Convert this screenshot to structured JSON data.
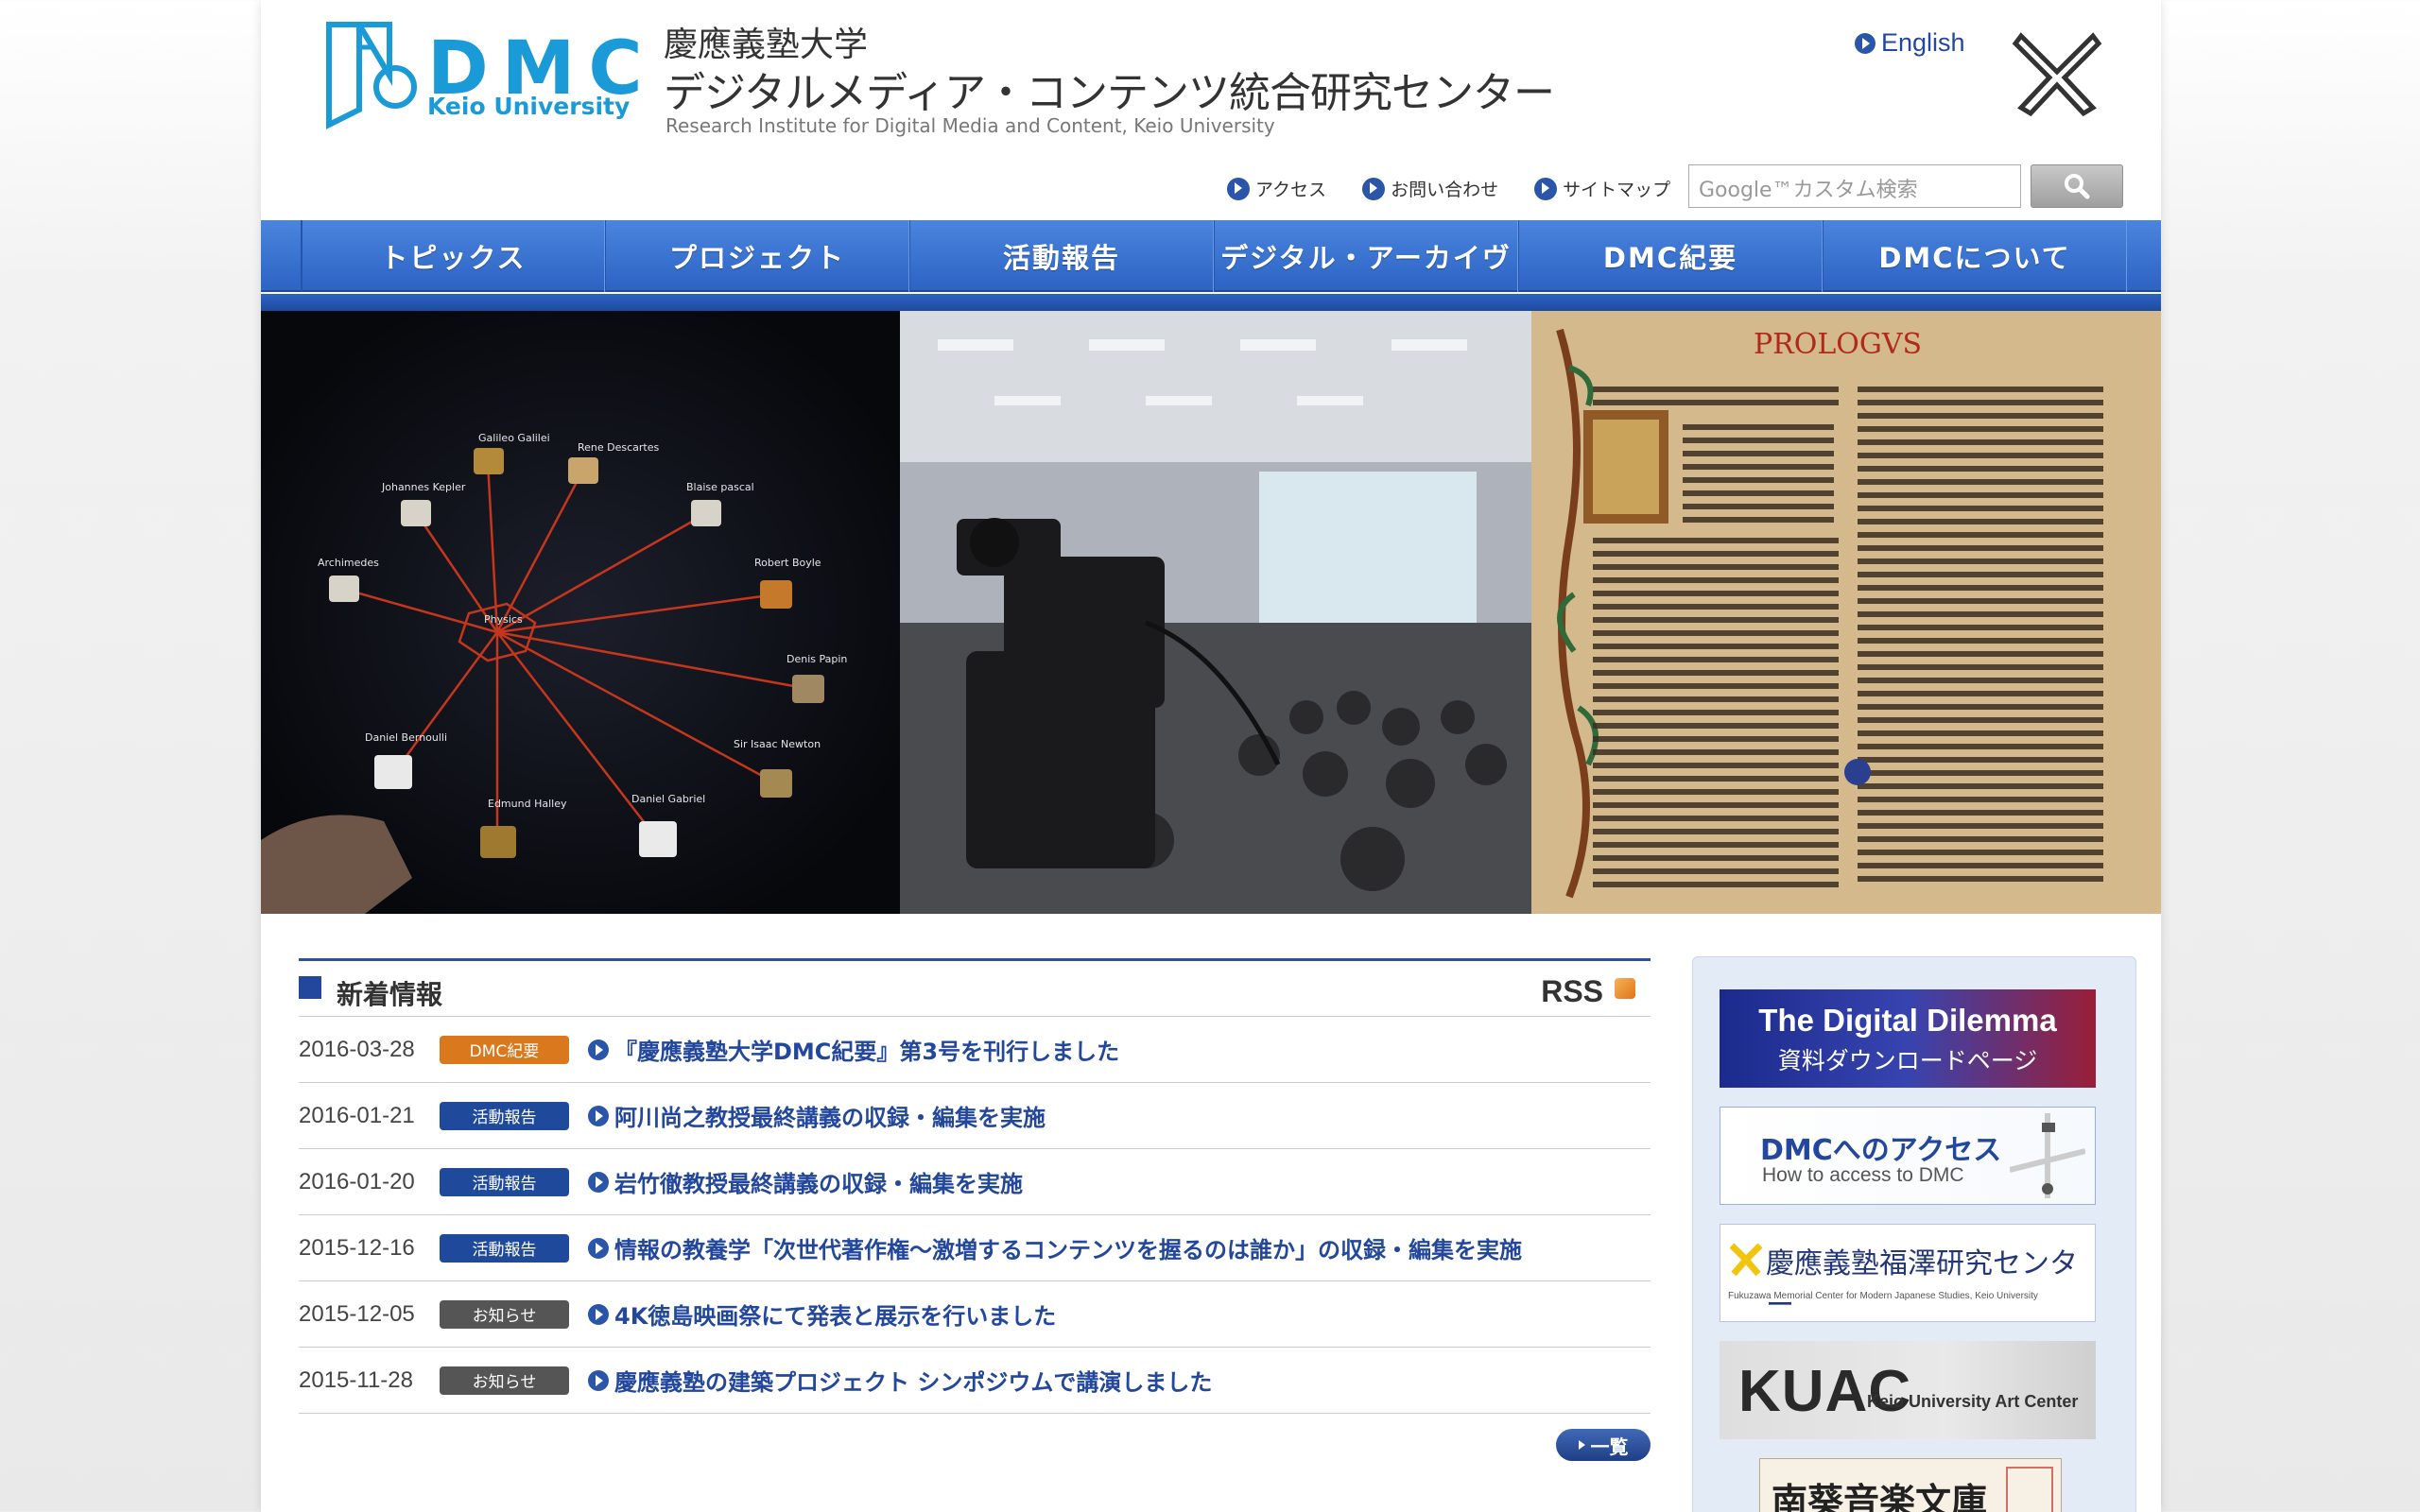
{
  "header": {
    "logo_text": "DMC",
    "logo_sub": "Keio University",
    "title_ja_line1": "慶應義塾大学",
    "title_ja_line2": "デジタルメディア・コンテンツ統合研究センター",
    "title_en": "Research Institute for Digital Media and Content, Keio University",
    "english_link": "English"
  },
  "utility_links": [
    "アクセス",
    "お問い合わせ",
    "サイトマップ"
  ],
  "search": {
    "placeholder": "Google™カスタム検索",
    "button_icon": "search-icon"
  },
  "nav": {
    "items": [
      "トピックス",
      "プロジェクト",
      "活動報告",
      "デジタル・アーカイヴ",
      "DMC紀要",
      "DMCについて"
    ]
  },
  "hero": {
    "panels": [
      "knowledge-graph-touchscreen",
      "lecture-recording-camera",
      "gutenberg-bible-prologue"
    ],
    "graph_labels": [
      "Galileo Galilei",
      "Rene Descartes",
      "Blaise pascal",
      "Johannes Kepler",
      "Archimedes",
      "Robert Boyle",
      "Denis Papin",
      "Sir Isaac Newton",
      "Daniel Bernoulli",
      "Edmund Halley",
      "Daniel Gabriel",
      "Physics"
    ],
    "book_heading": "PROLOGVS"
  },
  "news": {
    "title": "新着情報",
    "rss": "RSS",
    "items": [
      {
        "date": "2016-03-28",
        "badge": "DMC紀要",
        "badge_color": "#d9781c",
        "text": "『慶應義塾大学DMC紀要』第3号を刊行しました"
      },
      {
        "date": "2016-01-21",
        "badge": "活動報告",
        "badge_color": "#1f4a9c",
        "text": "阿川尚之教授最終講義の収録・編集を実施"
      },
      {
        "date": "2016-01-20",
        "badge": "活動報告",
        "badge_color": "#1f4a9c",
        "text": "岩竹徹教授最終講義の収録・編集を実施"
      },
      {
        "date": "2015-12-16",
        "badge": "活動報告",
        "badge_color": "#1f4a9c",
        "text": "情報の教養学「次世代著作権〜激増するコンテンツを握るのは誰か」の収録・編集を実施"
      },
      {
        "date": "2015-12-05",
        "badge": "お知らせ",
        "badge_color": "#555555",
        "text": "4K徳島映画祭にて発表と展示を行いました"
      },
      {
        "date": "2015-11-28",
        "badge": "お知らせ",
        "badge_color": "#555555",
        "text": "慶應義塾の建築プロジェクト シンポジウムで講演しました"
      }
    ],
    "list_button": "一覧"
  },
  "sidebar": {
    "dilemma_title": "The Digital Dilemma",
    "dilemma_sub": "資料ダウンロードページ",
    "access_title": "DMCへのアクセス",
    "access_sub": "How to access to DMC",
    "fukuzawa_title": "慶應義塾福澤研究センター",
    "fukuzawa_sub": "Fukuzawa Memorial Center for Modern Japanese Studies, Keio University",
    "kuac_title": "KUAC",
    "kuac_sub": "Keio University Art Center",
    "nanki_title": "南葵音楽文庫"
  },
  "colors": {
    "brand_blue": "#1a9ad6",
    "nav_blue": "#2d63c4",
    "link_blue": "#22479c"
  }
}
